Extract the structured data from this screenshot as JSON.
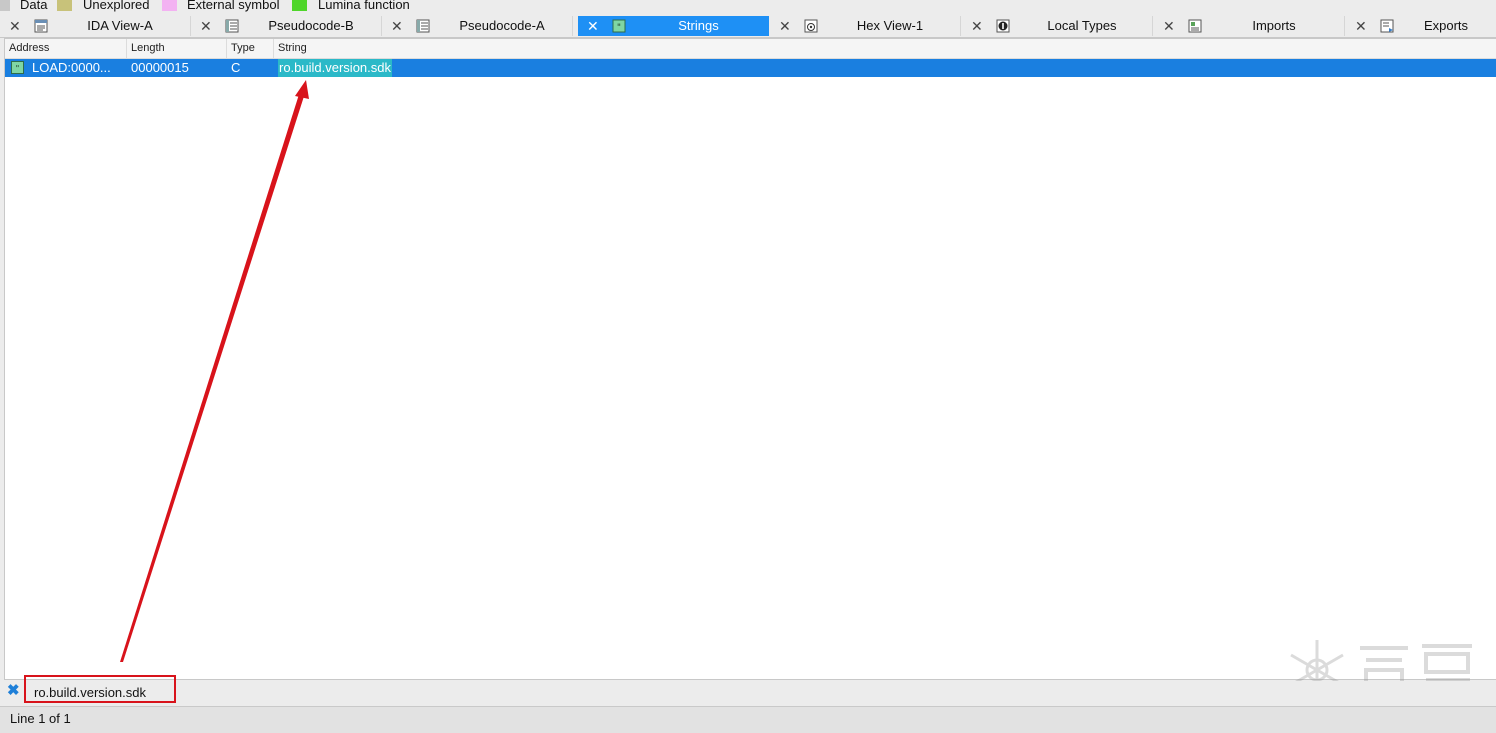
{
  "legend": [
    {
      "label": "Data",
      "color": "#c8c8c8"
    },
    {
      "label": "Unexplored",
      "color": "#c8c27a"
    },
    {
      "label": "External symbol",
      "color": "#f3b2f2"
    },
    {
      "label": "Lumina function",
      "color": "#4fd62a"
    }
  ],
  "tabs": [
    {
      "label": "IDA View-A",
      "icon": "disassembly-icon",
      "active": false
    },
    {
      "label": "Pseudocode-B",
      "icon": "pseudocode-icon",
      "active": false
    },
    {
      "label": "Pseudocode-A",
      "icon": "pseudocode-icon",
      "active": false
    },
    {
      "label": "Strings",
      "icon": "strings-icon",
      "active": true
    },
    {
      "label": "Hex View-1",
      "icon": "hex-view-icon",
      "active": false
    },
    {
      "label": "Local Types",
      "icon": "local-types-icon",
      "active": false
    },
    {
      "label": "Imports",
      "icon": "imports-icon",
      "active": false
    },
    {
      "label": "Exports",
      "icon": "exports-icon",
      "active": false
    }
  ],
  "columns": {
    "address": "Address",
    "length": "Length",
    "type": "Type",
    "string": "String"
  },
  "rows": [
    {
      "address": "LOAD:0000...",
      "length": "00000015",
      "type": "C",
      "string": "ro.build.version.sdk",
      "selected": true
    }
  ],
  "search": {
    "value": "ro.build.version.sdk"
  },
  "status": {
    "text": "Line 1 of 1"
  },
  "colors": {
    "accent": "#1e90f5",
    "selection": "#1a7fe0",
    "match_highlight": "#2bb9c8",
    "annotation": "#d8131b"
  }
}
